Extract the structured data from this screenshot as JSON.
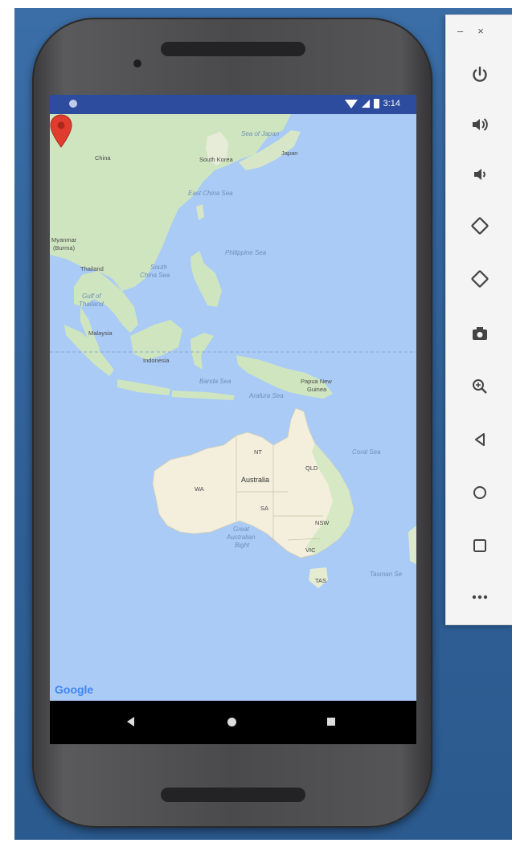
{
  "status_bar": {
    "time": "3:14"
  },
  "map": {
    "labels": {
      "sea_of_japan": "Sea of Japan",
      "china": "China",
      "south_korea": "South Korea",
      "japan": "Japan",
      "east_china_sea": "East China Sea",
      "myanmar": "Myanmar",
      "burma": "(Burma)",
      "thailand": "Thailand",
      "south_china_sea_1": "South",
      "south_china_sea_2": "China Sea",
      "gulf_1": "Gulf of",
      "gulf_2": "Thailand",
      "philippine_sea": "Philippine Sea",
      "malaysia": "Malaysia",
      "indonesia": "Indonesia",
      "banda_sea": "Banda Sea",
      "arafura_sea": "Arafura Sea",
      "png_1": "Papua New",
      "png_2": "Guinea",
      "coral_sea": "Coral Sea",
      "nt": "NT",
      "qld": "QLD",
      "wa": "WA",
      "australia": "Australia",
      "sa": "SA",
      "nsw": "NSW",
      "vic": "VIC",
      "bight_1": "Great",
      "bight_2": "Australian",
      "bight_3": "Bight",
      "tas": "TAS",
      "tasman_sea": "Tasman Se"
    },
    "marker_icon": "map-pin-icon",
    "attribution": "Google",
    "colors": {
      "water": "#a9cbf5",
      "land": "#f3efdc",
      "green_land": "#cfe5c0",
      "marker": "#e03d2f",
      "status_bar": "#2d4c9e"
    }
  },
  "navigation": {
    "back": "back-icon",
    "home": "home-icon",
    "recent": "recent-apps-icon"
  },
  "emulator_toolbar": {
    "minimize": "–",
    "close": "×",
    "buttons": [
      {
        "name": "power-icon",
        "glyph": "⏻"
      },
      {
        "name": "volume-up-icon",
        "glyph": "🔊"
      },
      {
        "name": "volume-down-icon",
        "glyph": "🔉"
      },
      {
        "name": "rotate-left-icon",
        "glyph": "◇"
      },
      {
        "name": "rotate-right-icon",
        "glyph": "◇"
      },
      {
        "name": "camera-icon",
        "glyph": "📷"
      },
      {
        "name": "zoom-icon",
        "glyph": "🔍"
      },
      {
        "name": "back-icon",
        "glyph": "◁"
      },
      {
        "name": "home-icon",
        "glyph": "○"
      },
      {
        "name": "overview-icon",
        "glyph": "□"
      },
      {
        "name": "more-icon",
        "glyph": "•••"
      }
    ]
  }
}
